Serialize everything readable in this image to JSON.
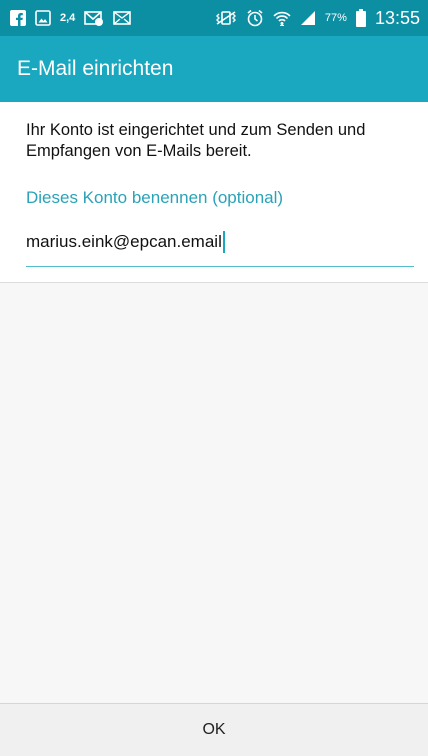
{
  "status_bar": {
    "notif_count": "2,4",
    "battery_pct": "77%",
    "time": "13:55",
    "icons": [
      "facebook-icon",
      "gallery-icon",
      "wifi-calling-icon",
      "mail-icon",
      "vibrate-icon",
      "alarm-icon",
      "wifi-icon",
      "signal-icon",
      "battery-icon"
    ]
  },
  "app_bar": {
    "title": "E-Mail einrichten"
  },
  "main": {
    "message": "Ihr Konto ist eingerichtet und zum Senden und Empfangen von E-Mails bereit.",
    "field_label": "Dieses Konto benennen (optional)",
    "account_name_value": "marius.eink@epcan.email"
  },
  "footer": {
    "ok_label": "OK"
  },
  "colors": {
    "status_bar": "#0d8fa3",
    "app_bar": "#19a8bf",
    "accent": "#2aa3b8"
  }
}
